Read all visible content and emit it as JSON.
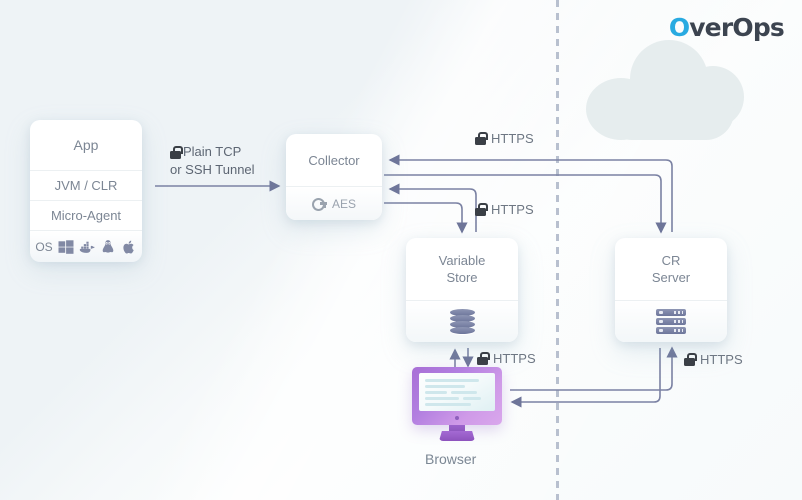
{
  "logo": {
    "mark": "O",
    "word": "verOps"
  },
  "app": {
    "title": "App",
    "runtime": "JVM / CLR",
    "agent": "Micro-Agent",
    "os_label": "OS",
    "os_icons": [
      "windows-icon",
      "docker-icon",
      "linux-icon",
      "apple-icon"
    ]
  },
  "collector": {
    "title": "Collector",
    "cipher": "AES",
    "cipher_icon": "key-icon"
  },
  "variable_store": {
    "title_line1": "Variable",
    "title_line2": "Store",
    "icon": "database-icon"
  },
  "cr_server": {
    "title_line1": "CR",
    "title_line2": "Server",
    "icon": "server-rack-icon"
  },
  "browser": {
    "label": "Browser",
    "icon": "desktop-monitor-icon"
  },
  "connections": {
    "app_to_collector": {
      "line1": "Plain TCP",
      "line2": "or SSH Tunnel",
      "icon": "lock-icon"
    },
    "collector_to_cr": {
      "label": "HTTPS",
      "icon": "lock-icon"
    },
    "collector_to_vs": {
      "label": "HTTPS",
      "icon": "lock-icon"
    },
    "browser_to_vs": {
      "label": "HTTPS",
      "icon": "lock-icon"
    },
    "browser_to_cr": {
      "label": "HTTPS",
      "icon": "lock-icon"
    }
  },
  "decor": {
    "cloud": "cloud-shape",
    "divider": "dashed-vertical-divider"
  },
  "colors": {
    "accent_blue": "#28aae1",
    "logo_text": "#3c4450",
    "wire": "#7b82a3",
    "card_text": "#7c8694",
    "lock": "#3a3f46",
    "cloud": "#e6edee",
    "divider": "#b8c0cf",
    "monitor_purple": "#a86fd6"
  }
}
